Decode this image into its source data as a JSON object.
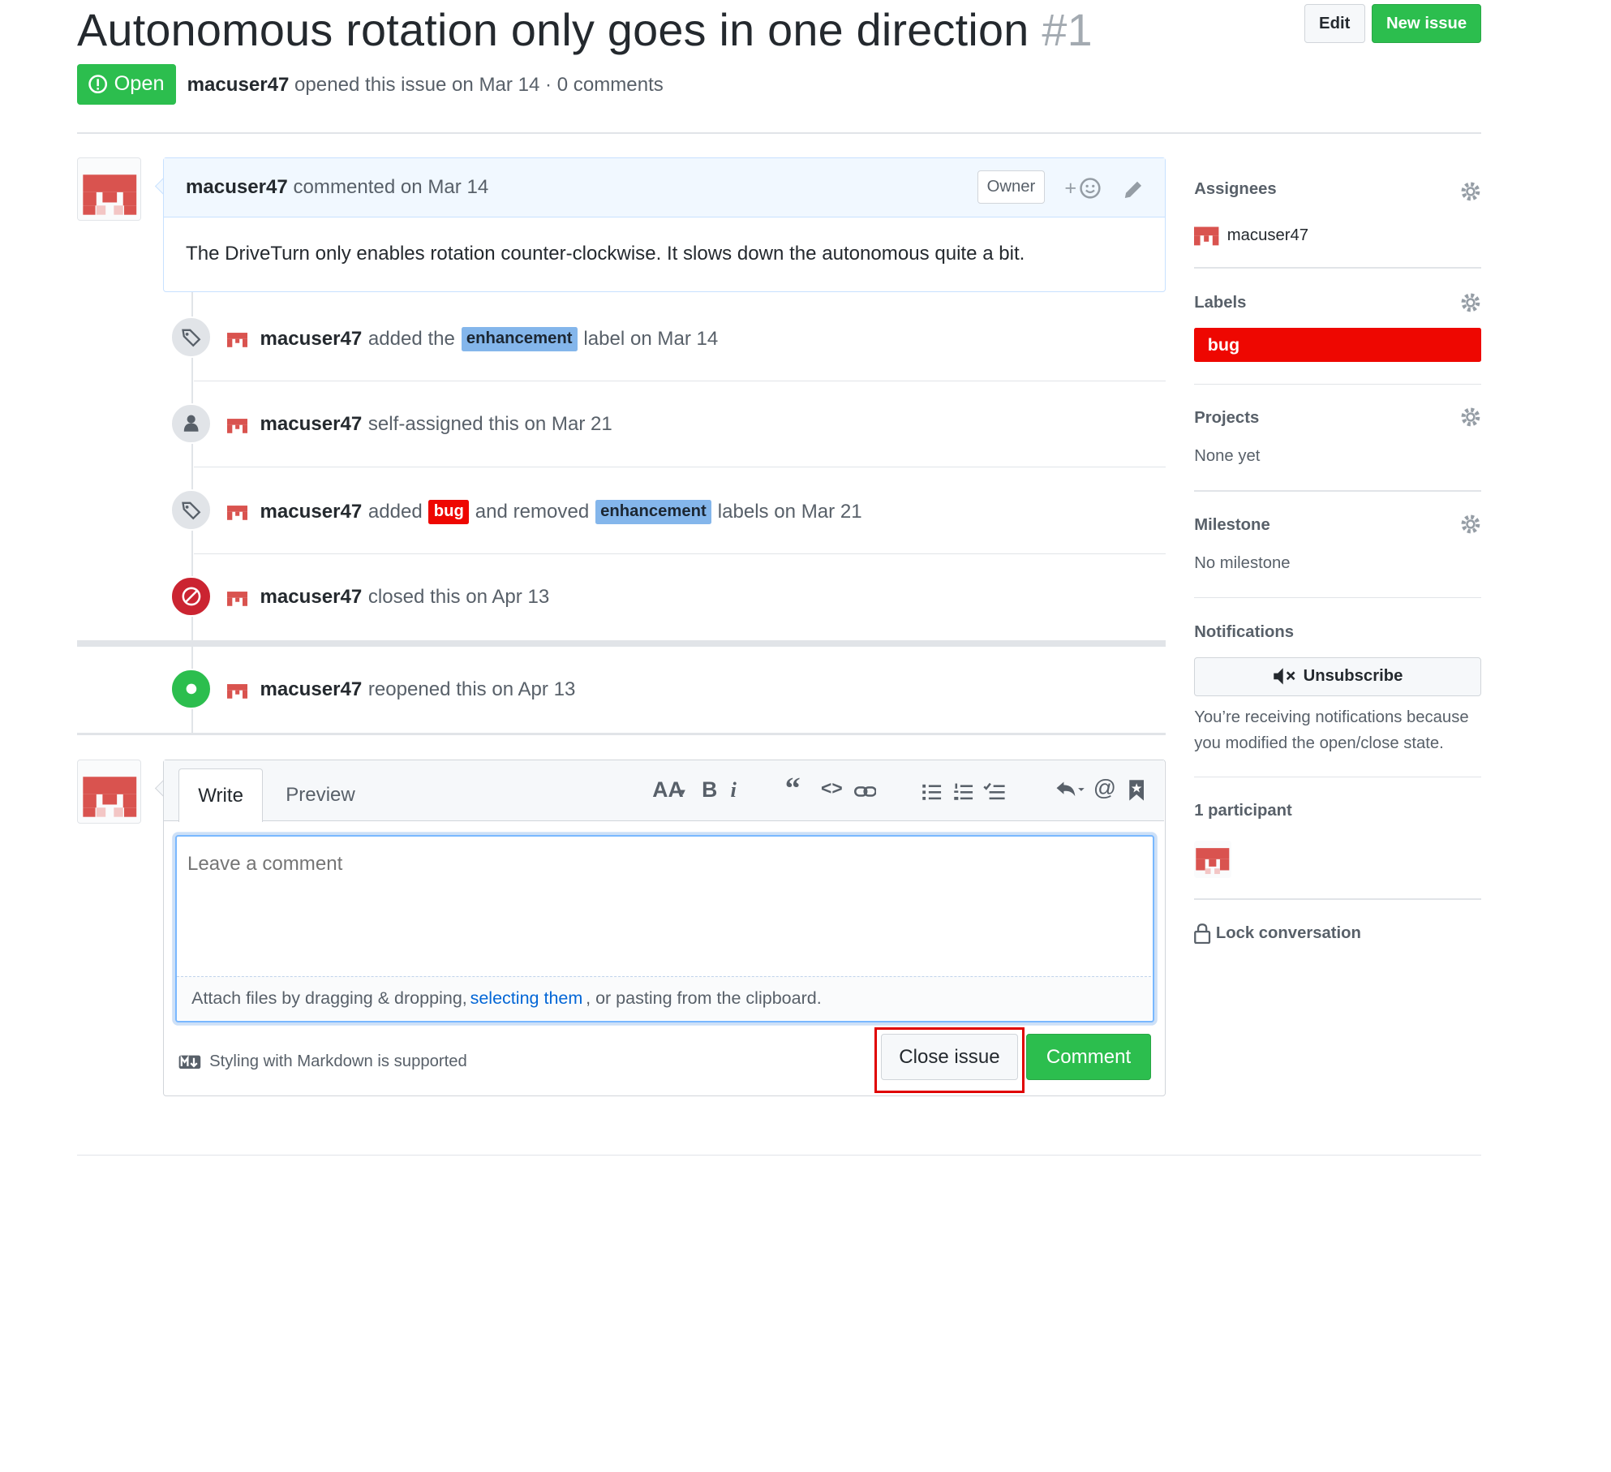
{
  "issue": {
    "title": "Autonomous rotation only goes in one direction",
    "number": "#1",
    "state": "Open",
    "author": "macuser47",
    "meta": "opened this issue on Mar 14 · 0 comments",
    "edit_label": "Edit",
    "new_issue_label": "New issue"
  },
  "comment": {
    "author": "macuser47",
    "when": "commented on Mar 14",
    "badge": "Owner",
    "reaction": "+",
    "body": "The DriveTurn only enables rotation counter-clockwise. It slows down the autonomous quite a bit."
  },
  "events": [
    {
      "actor": "macuser47",
      "pre": "added the",
      "label": "enhancement",
      "post": "label on Mar 14"
    },
    {
      "actor": "macuser47",
      "text": "self-assigned this on Mar 21"
    },
    {
      "actor": "macuser47",
      "pre": "added",
      "label_added": "bug",
      "mid": "and removed",
      "label_removed": "enhancement",
      "post": "labels on Mar 21"
    },
    {
      "actor": "macuser47",
      "text": "closed this on Apr 13"
    },
    {
      "actor": "macuser47",
      "text": "reopened this on Apr 13"
    }
  ],
  "editor": {
    "tab_write": "Write",
    "tab_preview": "Preview",
    "toolbar": {
      "heading": "AA",
      "bold": "B",
      "italic": "i",
      "quote": "“",
      "code": "<>",
      "mention": "@"
    },
    "placeholder": "Leave a comment",
    "attach_pre": "Attach files by dragging & dropping,",
    "attach_link": "selecting them",
    "attach_post": ", or pasting from the clipboard.",
    "markdown_note": "Styling with Markdown is supported",
    "close_label": "Close issue",
    "comment_label": "Comment"
  },
  "sidebar": {
    "assignees_h": "Assignees",
    "assignee": "macuser47",
    "labels_h": "Labels",
    "label": "bug",
    "projects_h": "Projects",
    "projects_v": "None yet",
    "milestone_h": "Milestone",
    "milestone_v": "No milestone",
    "notifications_h": "Notifications",
    "unsubscribe": "Unsubscribe",
    "notif_reason": "You’re receiving notifications because you modified the open/close state.",
    "participants_h": "1 participant",
    "lock": "Lock conversation"
  },
  "colors": {
    "green": "#2cbe4e",
    "bug": "#ee0701",
    "enhancement": "#84b6eb",
    "closed": "#cb2431",
    "link": "#0366d6"
  }
}
